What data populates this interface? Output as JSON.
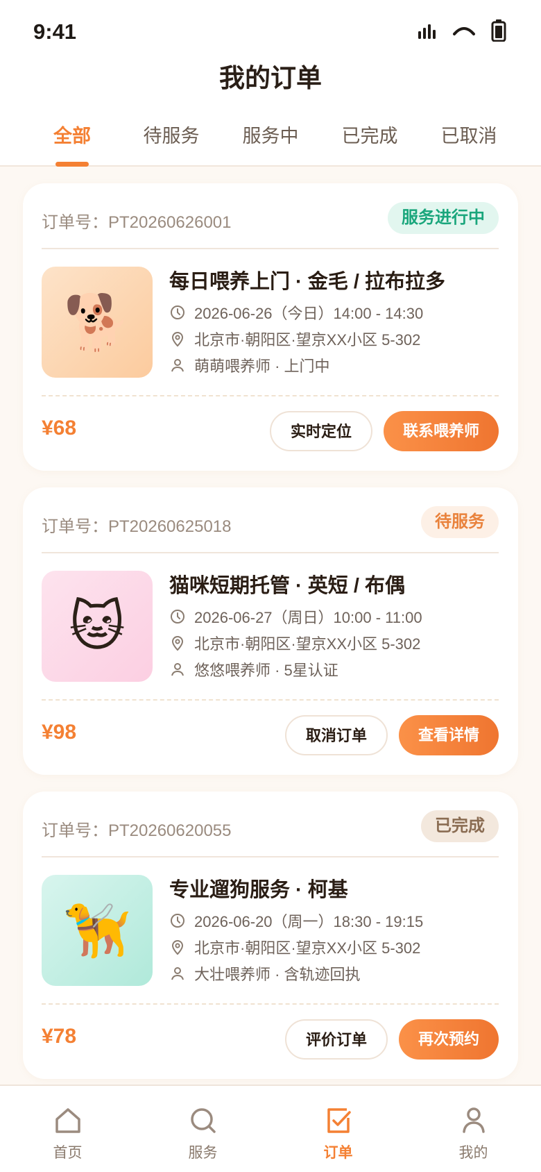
{
  "status_bar": {
    "time": "9:41"
  },
  "page": {
    "title": "我的订单"
  },
  "tabs": [
    {
      "label": "全部",
      "active": true
    },
    {
      "label": "待服务",
      "active": false
    },
    {
      "label": "服务中",
      "active": false
    },
    {
      "label": "已完成",
      "active": false
    },
    {
      "label": "已取消",
      "active": false
    }
  ],
  "orders": [
    {
      "order_no": "订单号：PT20260626001",
      "status": "服务进行中",
      "status_type": "ongoing",
      "thumb_emoji": "🐕",
      "title": "每日喂养上门 · 金毛 / 拉布拉多",
      "time": "2026-06-26（今日）14:00 - 14:30",
      "address": "北京市·朝阳区·望京XX小区 5-302",
      "sitter": "萌萌喂养师 · 上门中",
      "price": "¥68",
      "secondary_action": "实时定位",
      "primary_action": "联系喂养师"
    },
    {
      "order_no": "订单号：PT20260625018",
      "status": "待服务",
      "status_type": "pending",
      "thumb_emoji": "🐱",
      "title": "猫咪短期托管 · 英短 / 布偶",
      "time": "2026-06-27（周日）10:00 - 11:00",
      "address": "北京市·朝阳区·望京XX小区 5-302",
      "sitter": "悠悠喂养师 · 5星认证",
      "price": "¥98",
      "secondary_action": "取消订单",
      "primary_action": "查看详情"
    },
    {
      "order_no": "订单号：PT20260620055",
      "status": "已完成",
      "status_type": "done",
      "thumb_emoji": "🦮",
      "title": "专业遛狗服务 · 柯基",
      "time": "2026-06-20（周一）18:30 - 19:15",
      "address": "北京市·朝阳区·望京XX小区 5-302",
      "sitter": "大壮喂养师 · 含轨迹回执",
      "price": "¥78",
      "secondary_action": "评价订单",
      "primary_action": "再次预约"
    }
  ],
  "tabbar": [
    {
      "label": "首页",
      "icon": "home-icon",
      "active": false
    },
    {
      "label": "服务",
      "icon": "search-icon",
      "active": false
    },
    {
      "label": "订单",
      "icon": "order-check-icon",
      "active": true
    },
    {
      "label": "我的",
      "icon": "profile-icon",
      "active": false
    }
  ],
  "colors": {
    "accent": "#f48033",
    "ongoing": "#1aa67c",
    "text_dark": "#2a1d14"
  }
}
